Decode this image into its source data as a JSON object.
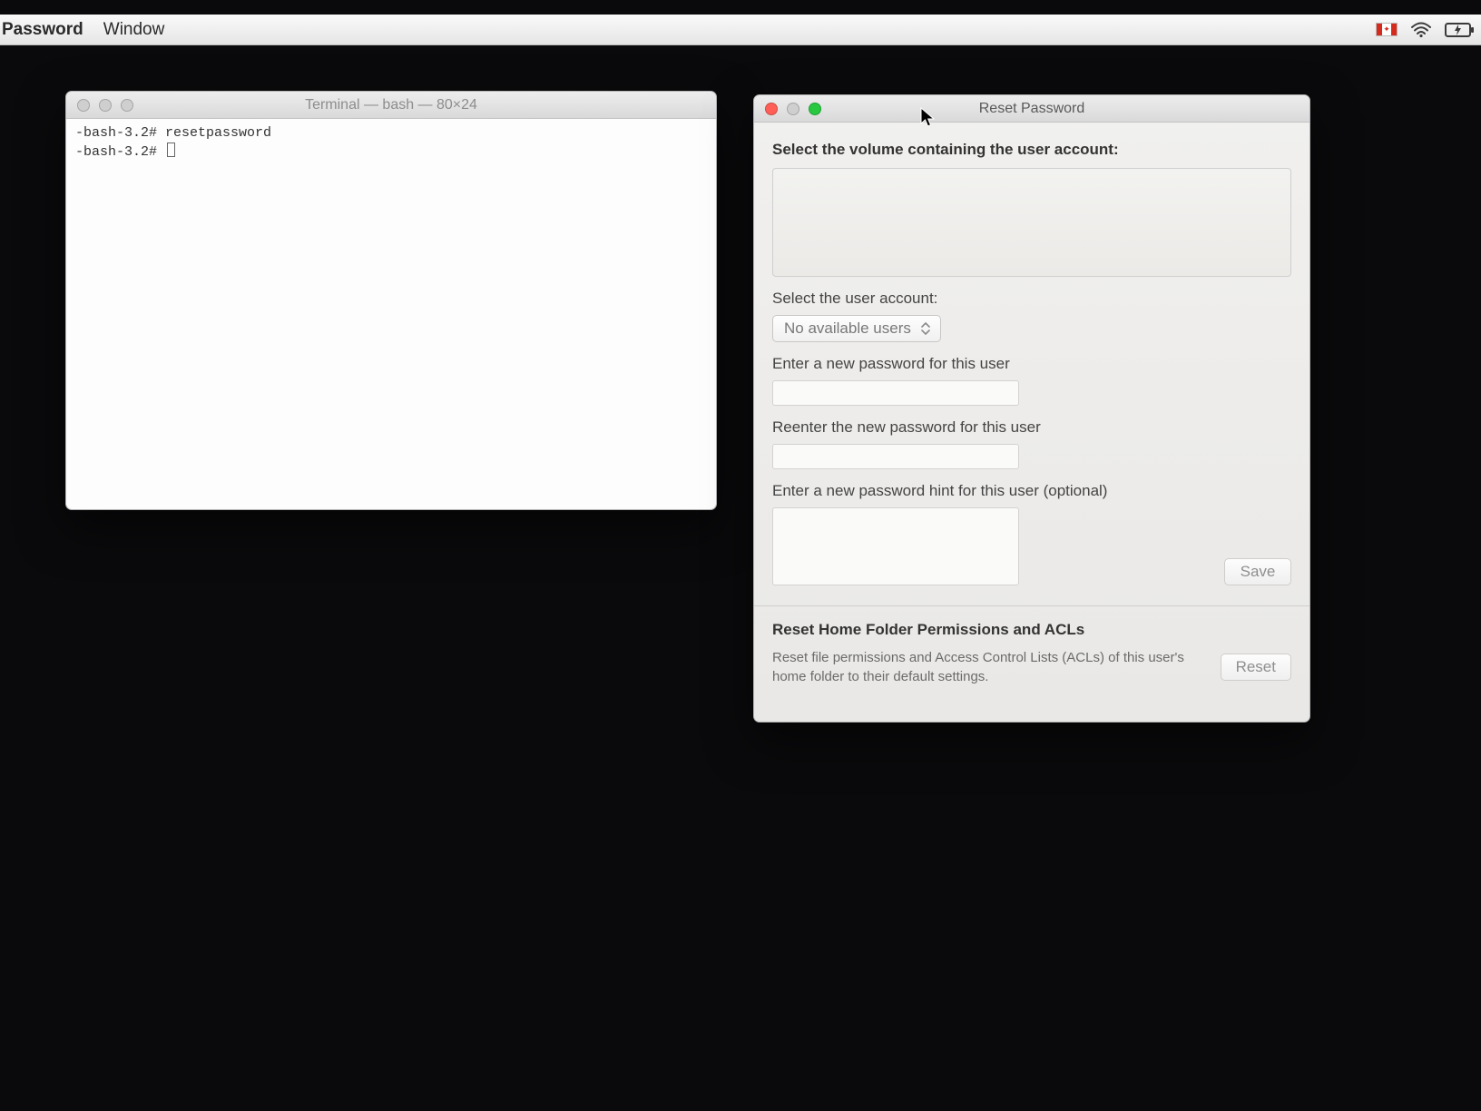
{
  "menubar": {
    "app_menu": "Password",
    "window_menu": "Window"
  },
  "terminal": {
    "title": "Terminal — bash — 80×24",
    "line1": "-bash-3.2# resetpassword",
    "line2": "-bash-3.2# "
  },
  "resetpw": {
    "title": "Reset Password",
    "volume_label": "Select the volume containing the user account:",
    "user_label": "Select the user account:",
    "user_select_value": "No available users",
    "newpw_label": "Enter a new password for this user",
    "reenter_label": "Reenter the new password for this user",
    "hint_label": "Enter a new password hint for this user (optional)",
    "save_button": "Save",
    "acl_heading": "Reset Home Folder Permissions and ACLs",
    "acl_desc": "Reset file permissions and Access Control Lists (ACLs) of this user's home folder to their default settings.",
    "reset_button": "Reset"
  }
}
